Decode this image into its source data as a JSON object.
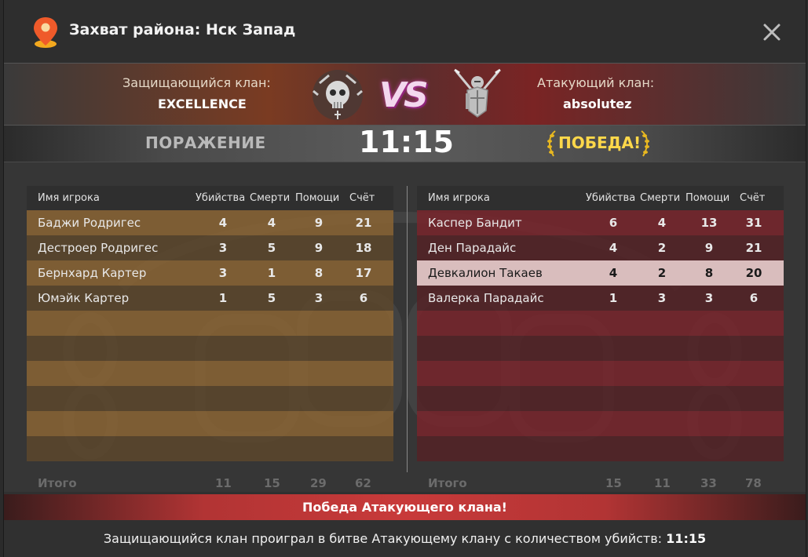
{
  "title": "Захват района: Нск Запад",
  "banner": {
    "defender_label": "Защищающийся клан:",
    "defender_name": "EXCELLENCE",
    "vs": "VS",
    "attacker_label": "Атакующий клан:",
    "attacker_name": "absolutez"
  },
  "result": {
    "left": "ПОРАЖЕНИЕ",
    "time": "11:15",
    "right": "ПОБЕДА!"
  },
  "columns": {
    "player": "Имя игрока",
    "kills": "Убийства",
    "deaths": "Смерти",
    "assists": "Помощи",
    "score": "Счёт"
  },
  "defenders": {
    "rows": [
      {
        "name": "Баджи Родригес",
        "kills": "4",
        "deaths": "4",
        "assists": "9",
        "score": "21"
      },
      {
        "name": "Дестроер Родригес",
        "kills": "3",
        "deaths": "5",
        "assists": "9",
        "score": "18"
      },
      {
        "name": "Бернхард Картер",
        "kills": "3",
        "deaths": "1",
        "assists": "8",
        "score": "17"
      },
      {
        "name": "Юмэйк Картер",
        "kills": "1",
        "deaths": "5",
        "assists": "3",
        "score": "6"
      }
    ],
    "totals": {
      "label": "Итого",
      "kills": "11",
      "deaths": "15",
      "assists": "29",
      "score": "62"
    }
  },
  "attackers": {
    "rows": [
      {
        "name": "Каспер Бандит",
        "kills": "6",
        "deaths": "4",
        "assists": "13",
        "score": "31"
      },
      {
        "name": "Ден Парадайс",
        "kills": "4",
        "deaths": "2",
        "assists": "9",
        "score": "21"
      },
      {
        "name": "Девкалион Такаев",
        "kills": "4",
        "deaths": "2",
        "assists": "8",
        "score": "20"
      },
      {
        "name": "Валерка Парадайс",
        "kills": "1",
        "deaths": "3",
        "assists": "3",
        "score": "6"
      }
    ],
    "totals": {
      "label": "Итого",
      "kills": "15",
      "deaths": "11",
      "assists": "33",
      "score": "78"
    }
  },
  "victory_banner": "Победа Атакующего клана!",
  "summary_text": "Защищающийся клан проиграл в битве Атакующему клану с количеством убийств:",
  "summary_value": "11:15",
  "icons": {
    "title": "map-pin-icon",
    "close": "close-icon",
    "defender_emblem": "skull-emblem-icon",
    "attacker_emblem": "knight-shield-icon",
    "laurel": "laurel-icon"
  },
  "colors": {
    "victory": "#ffd84a",
    "defender_row": "#8a6434",
    "attacker_row": "#78242c",
    "banner_red": "#c83a3a"
  }
}
